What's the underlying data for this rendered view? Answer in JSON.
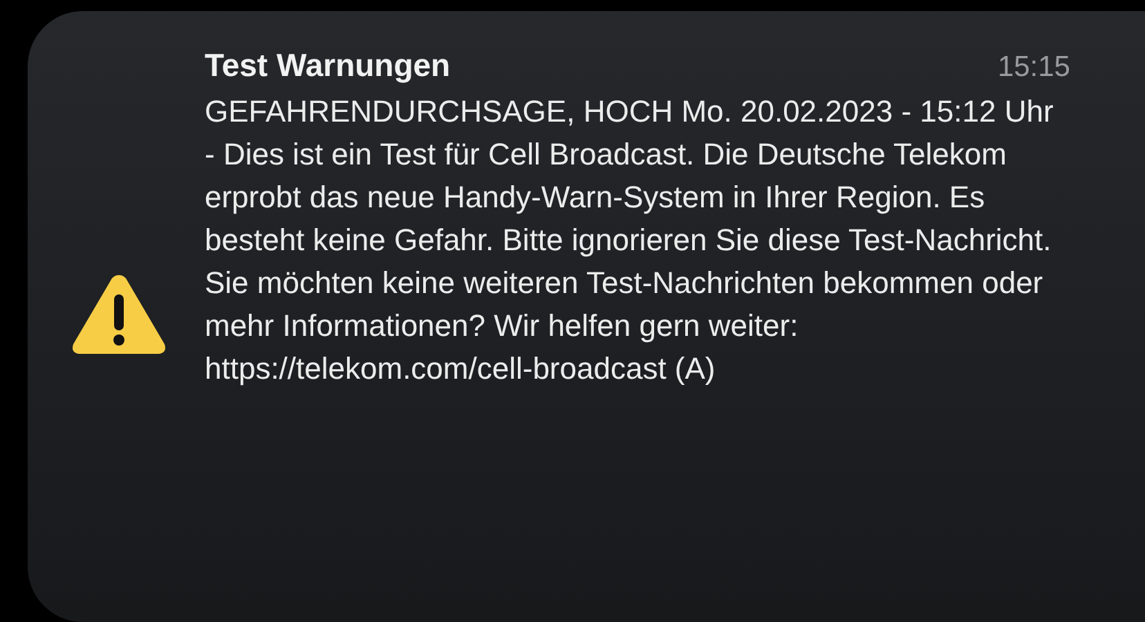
{
  "notification": {
    "title": "Test Warnungen",
    "time": "15:15",
    "body": "GEFAHRENDURCHSAGE, HOCH Mo. 20.02.2023 - 15:12 Uhr - Dies ist ein Test für Cell Broadcast. Die Deutsche Telekom erprobt das neue Handy-Warn-System in Ihrer Region. Es besteht keine Gefahr. Bitte ignorieren Sie diese Test-Nachricht. Sie möchten keine weiteren Test-Nachrichten bekommen oder mehr Informationen? Wir helfen gern weiter: https://telekom.com/cell-broadcast (A)"
  }
}
